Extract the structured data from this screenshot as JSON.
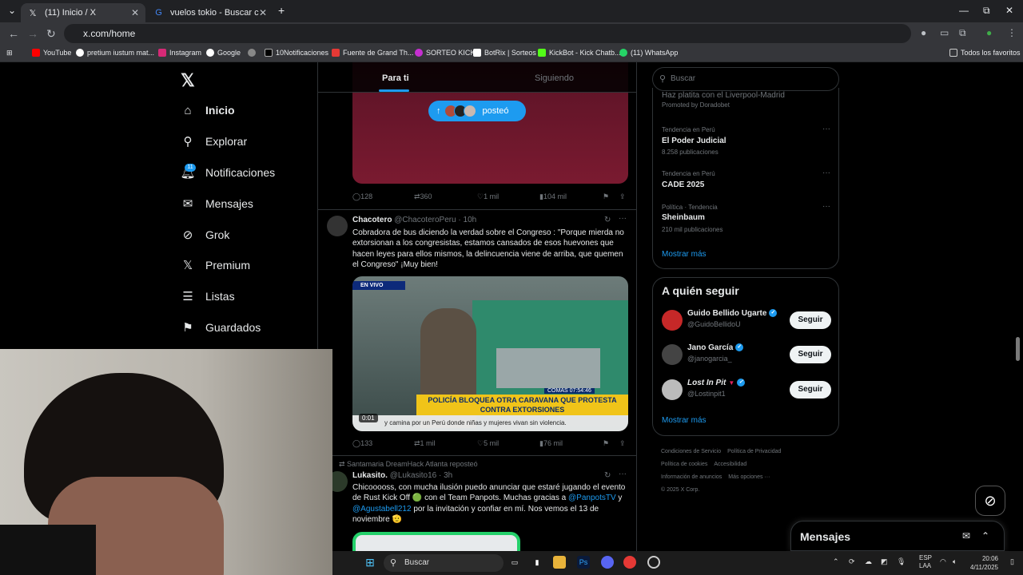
{
  "browser": {
    "tabs": [
      {
        "title": "(11) Inicio / X",
        "icon": "x-icon"
      },
      {
        "title": "vuelos tokio - Buscar con Goog",
        "icon": "google-icon"
      }
    ],
    "new_tab": "+",
    "url": "x.com/home",
    "bookmarks": [
      {
        "label": "YouTube",
        "color": "#ff0000"
      },
      {
        "label": "pretium iustum mat...",
        "color": "#ffffff"
      },
      {
        "label": "Instagram",
        "color": "#d62976"
      },
      {
        "label": "Google",
        "color": "#ffffff"
      },
      {
        "label": "",
        "color": "#888888"
      },
      {
        "label": "10Notificaciones",
        "color": "#000000"
      },
      {
        "label": "Fuente de Grand Th...",
        "color": "#e53935"
      },
      {
        "label": "SORTEO KICK",
        "color": "#c52fd0"
      },
      {
        "label": "BotRix | Sorteos",
        "color": "#ffffff"
      },
      {
        "label": "KickBot - Kick Chatb...",
        "color": "#53fc18"
      },
      {
        "label": "(11) WhatsApp",
        "color": "#25d366"
      }
    ],
    "all_bookmarks": "Todos los favoritos"
  },
  "nav": {
    "items": [
      {
        "label": "Inicio",
        "icon": "home-icon"
      },
      {
        "label": "Explorar",
        "icon": "search-icon"
      },
      {
        "label": "Notificaciones",
        "icon": "bell-icon"
      },
      {
        "label": "Mensajes",
        "icon": "mail-icon"
      },
      {
        "label": "Grok",
        "icon": "grok-icon"
      },
      {
        "label": "Premium",
        "icon": "x-icon"
      },
      {
        "label": "Listas",
        "icon": "list-icon"
      },
      {
        "label": "Guardados",
        "icon": "bookmark-icon"
      }
    ],
    "notif_badge": "11"
  },
  "feed": {
    "tabs": [
      "Para ti",
      "Siguiendo"
    ],
    "new_posts_label": "posteó",
    "tweet1_actions": {
      "replies": "128",
      "retweets": "360",
      "likes": "1 mil",
      "views": "104 mil"
    },
    "tweet2": {
      "name": "Chacotero",
      "handle": "@ChacoteroPeru · 10h",
      "text": "Cobradora de bus diciendo la verdad sobre el Congreso : \"Porque mierda no extorsionan a los congresistas, estamos cansados de esos huevones que hacen leyes para ellos mismos, la delincuencia viene de arriba, que quemen el Congreso\" ¡Muy bien!",
      "video": {
        "live": "EN VIVO",
        "headline": "POLICÍA BLOQUEA OTRA CARAVANA QUE PROTESTA CONTRA EXTORSIONES",
        "ticker": "y camina por un Perú donde niñas y mujeres vivan sin violencia.",
        "clock": "COMAS 07:54:46",
        "duration": "0:01"
      },
      "actions": {
        "replies": "133",
        "retweets": "1 mil",
        "likes": "5 mil",
        "views": "76 mil"
      }
    },
    "tweet3": {
      "repost_line": "Santamaria DreamHack Atlanta reposteó",
      "name": "Lukasito.",
      "handle": "@Lukasito16 · 3h",
      "text_a": "Chicooooss, con mucha ilusión puedo anunciar que estaré jugando el evento de Rust Kick Off 🟢 con el Team Panpots. Muchas gracias a ",
      "mention1": "@PanpotsTV",
      "text_b": " y ",
      "mention2": "@Agustabell212",
      "text_c": " por la invitación y confiar en mí. Nos vemos el 13 de noviembre 🫡"
    }
  },
  "sidebar": {
    "search_placeholder": "Buscar",
    "promo_title": "Haz platita con el Liverpool-Madrid",
    "promo_by": "Promoted by Doradobet",
    "trends": [
      {
        "context": "Tendencia en Perú",
        "name": "El Poder Judicial",
        "count": "8.258 publicaciones"
      },
      {
        "context": "Tendencia en Perú",
        "name": "CADE 2025",
        "count": ""
      },
      {
        "context": "Política · Tendencia",
        "name": "Sheinbaum",
        "count": "210 mil publicaciones"
      }
    ],
    "show_more": "Mostrar más",
    "who_to_follow": "A quién seguir",
    "follow": [
      {
        "name": "Guido Bellido Ugarte",
        "handle": "@GuidoBellidoU",
        "button": "Seguir"
      },
      {
        "name": "Jano García",
        "handle": "@janogarcia_",
        "button": "Seguir"
      },
      {
        "name": "Lost In Pit",
        "handle": "@Lostinpit1",
        "button": "Seguir"
      }
    ],
    "follow_more": "Mostrar más",
    "footer": [
      "Condiciones de Servicio",
      "Política de Privacidad",
      "Política de cookies",
      "Accesibilidad",
      "Información de anuncios",
      "Más opciones ···",
      "© 2025 X Corp."
    ]
  },
  "messages_bar": "Mensajes",
  "taskbar": {
    "search": "Buscar",
    "lang": "ESP",
    "lang2": "LAA",
    "time": "20:06",
    "date": "4/11/2025"
  }
}
